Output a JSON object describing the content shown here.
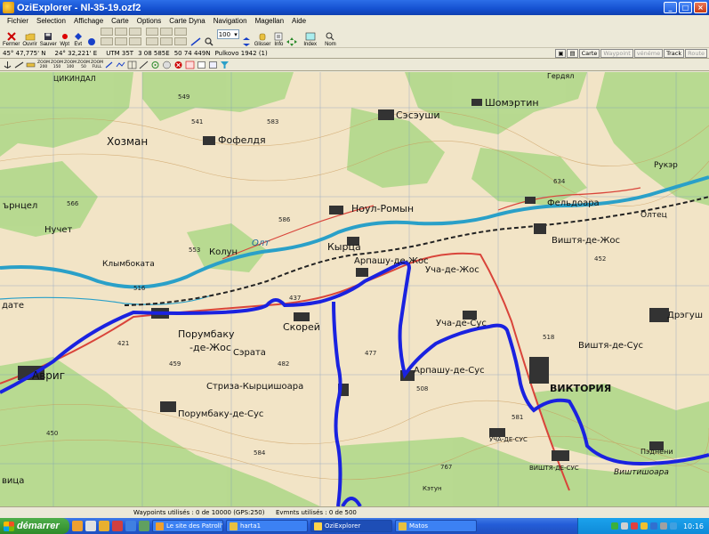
{
  "window": {
    "title": "OziExplorer - Nl-35-19.ozf2",
    "minimize_icon": "minimize-icon",
    "maximize_icon": "maximize-icon",
    "close_icon": "close-icon"
  },
  "menu": [
    "Fichier",
    "Selection",
    "Affichage",
    "Carte",
    "Options",
    "Carte Dyna",
    "Navigation",
    "Magellan",
    "Aide"
  ],
  "toolbar": {
    "fermer": "Fermer",
    "ouvrir": "Ouvrir",
    "sauver": "Sauver",
    "wpt": "Wpt",
    "evt": "Evt",
    "zoom_value": "100",
    "glisser": "Glisser",
    "info": "Info",
    "index": "Index",
    "nom": "Nom"
  },
  "status": {
    "lat": "45° 47,775' N",
    "lon": "24° 32,221' E",
    "utm": "UTM  35T",
    "easting": "3 08 585E",
    "northing": "50 74 449N",
    "datum": "Pulkovo 1942 (1)",
    "buttons": {
      "carte": "Carte",
      "waypoint": "Waypoint",
      "evenement": "vénéme",
      "track": "Track",
      "route": "Route"
    }
  },
  "zoom_buttons": [
    {
      "line1": "ZOOM",
      "line2": "200"
    },
    {
      "line1": "ZOOM",
      "line2": "150"
    },
    {
      "line1": "ZOOM",
      "line2": "100"
    },
    {
      "line1": "ZOOM",
      "line2": "50"
    },
    {
      "line1": "ZOOM",
      "line2": "FULL"
    }
  ],
  "map": {
    "labels": {
      "hozman": "Хозман",
      "fofeldja": "Фофелдя",
      "saseushi": "Сэсэуши",
      "shomertin": "Шомэртин",
      "nuchet": "Нучет",
      "noul_romyn": "Ноул-Ромын",
      "feldioara": "Фельдоара",
      "kolun": "Колун",
      "klymbokata": "Клымбоката",
      "kyrtsa": "Кырца",
      "arpashu_de_zhos": "Арпашу-де-Жос",
      "ucha_de_zhos": "Уча-де-Жос",
      "vishtja_de_zhos": "Виштя-де-Жос",
      "oltets": "Олтец",
      "porumbaku_de_zhos_1": "Порумбаку",
      "porumbaku_de_zhos_2": "-де-Жос",
      "skorei": "Скорей",
      "ucha_de_sus": "Уча-де-Сус",
      "vishtja_de_sus": "Виштя-де-Сус",
      "dregush": "Дрэгуш",
      "avrig": "Авриг",
      "srata": "Сэрата",
      "striza": "Стриза-Кырцишоара",
      "arpashu_de_sus": "Арпашу-де-Сус",
      "victoria": "ВИКТОРИЯ",
      "porumbaku_de_sus": "Порумбаку-де-Сус",
      "ucha_de_sus_small": "УЧА-ДЕ-СУС",
      "vishtja_de_sus_small": "ВИШТЯ-ДЕ-СУС",
      "vishtishoara": "Виштишоара",
      "olt": "Олт",
      "rukar": "Рукэр",
      "gerdjal": "Гердял",
      "tsikindal": "ЦИКИНДАЛ",
      "ornjetsel": "ърнцел",
      "datе": "дате",
      "vitsa": "вица",
      "laneri": "Пэднени",
      "katun": "Кэтун"
    },
    "elevations": [
      "566",
      "549",
      "541",
      "583",
      "586",
      "553",
      "516",
      "634",
      "421",
      "459",
      "482",
      "437",
      "477",
      "508",
      "452",
      "518",
      "450",
      "584",
      "581",
      "767"
    ]
  },
  "bottom": {
    "waypoints": "Waypoints utilisés : 0 de 10000  (GPS:250)",
    "events": "Evmnts utilisés : 0 de 500"
  },
  "taskbar": {
    "start": "démarrer",
    "tasks": [
      "Le site des Patroll'...",
      "harta1",
      "OziExplorer",
      "Matos"
    ],
    "clock": "10:16"
  },
  "colors": {
    "title_bar": "#1450d0",
    "track": "#1a22e0",
    "forest": "#a8d48a",
    "road": "#d9443a",
    "river": "#2aa0c8",
    "taskbar": "#245dd8",
    "start_button": "#2e8a2a"
  }
}
